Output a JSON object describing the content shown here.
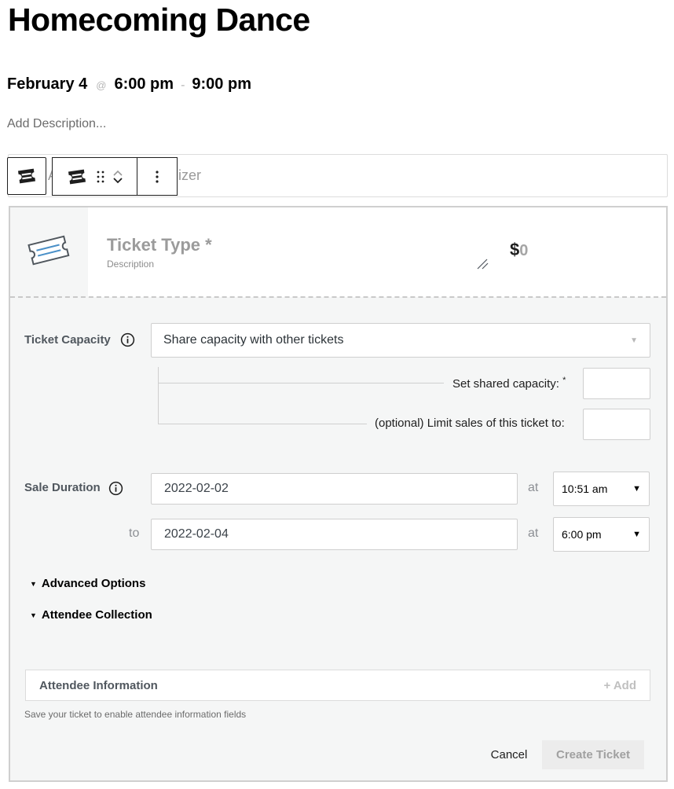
{
  "event": {
    "title": "Homecoming Dance",
    "date": "February 4",
    "at_symbol": "@",
    "start_time": "6:00 pm",
    "dash": "-",
    "end_time": "9:00 pm",
    "add_description": "Add Description..."
  },
  "organizer": {
    "ghost_letter": "A",
    "placeholder_tail": "izer"
  },
  "toolbar": {
    "ticket_icon": "ticket-icon",
    "drag_icon": "drag-handle-icon",
    "move_icon": "chevron-up-down-icon",
    "more_icon": "more-vertical-icon"
  },
  "ticket": {
    "type_placeholder": "Ticket Type *",
    "description_placeholder": "Description",
    "currency": "$",
    "price": "0"
  },
  "capacity": {
    "label": "Ticket Capacity",
    "selected": "Share capacity with other tickets",
    "shared_label": "Set shared capacity:",
    "shared_required": "*",
    "limit_label": "(optional) Limit sales of this ticket to:"
  },
  "sale": {
    "label": "Sale Duration",
    "start_date": "2022-02-02",
    "at": "at",
    "start_time": "10:51 am",
    "to": "to",
    "end_date": "2022-02-04",
    "end_time": "6:00 pm"
  },
  "sections": {
    "advanced": "Advanced Options",
    "attendee_collection": "Attendee Collection"
  },
  "attendee_info": {
    "title": "Attendee Information",
    "add": "+ Add",
    "note": "Save your ticket to enable attendee information fields"
  },
  "actions": {
    "cancel": "Cancel",
    "create": "Create Ticket"
  },
  "colors": {
    "panel_bg": "#f5f6f6",
    "ticket_blue": "#4a90c8",
    "disabled_text": "#a0a0a0"
  }
}
